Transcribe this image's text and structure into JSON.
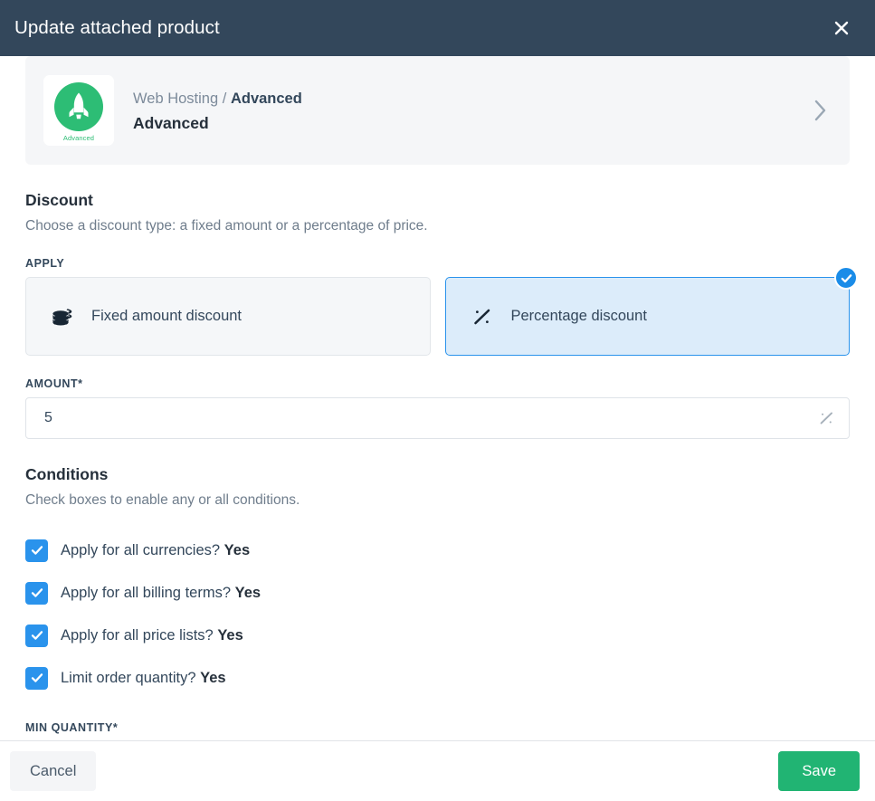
{
  "header": {
    "title": "Update attached product",
    "close_icon": "close-icon"
  },
  "product": {
    "thumb_icon": "rocket-icon",
    "thumb_caption": "Advanced",
    "breadcrumb_parent": "Web Hosting",
    "breadcrumb_separator": "/",
    "breadcrumb_current": "Advanced",
    "name": "Advanced",
    "chevron_icon": "chevron-right-icon"
  },
  "discount": {
    "title": "Discount",
    "description": "Choose a discount type: a fixed amount or a percentage of price.",
    "apply_label": "APPLY",
    "options": [
      {
        "label": "Fixed amount discount",
        "icon": "coins-stack-icon",
        "selected": false
      },
      {
        "label": "Percentage discount",
        "icon": "percent-icon",
        "selected": true
      }
    ],
    "amount_label": "AMOUNT*",
    "amount_value": "5",
    "amount_placeholder": "",
    "amount_suffix_icon": "percent-icon"
  },
  "conditions": {
    "title": "Conditions",
    "description": "Check boxes to enable any or all conditions.",
    "items": [
      {
        "question": "Apply for all currencies?",
        "answer": "Yes",
        "checked": true
      },
      {
        "question": "Apply for all billing terms?",
        "answer": "Yes",
        "checked": true
      },
      {
        "question": "Apply for all price lists?",
        "answer": "Yes",
        "checked": true
      },
      {
        "question": "Limit order quantity?",
        "answer": "Yes",
        "checked": true
      }
    ],
    "min_quantity_label": "MIN QUANTITY*"
  },
  "footer": {
    "cancel_label": "Cancel",
    "save_label": "Save"
  },
  "colors": {
    "header_bg": "#33475b",
    "accent_blue": "#2a93ec",
    "badge_blue": "#1a8ce8",
    "save_green": "#21b473",
    "brand_green": "#2dbd75"
  }
}
